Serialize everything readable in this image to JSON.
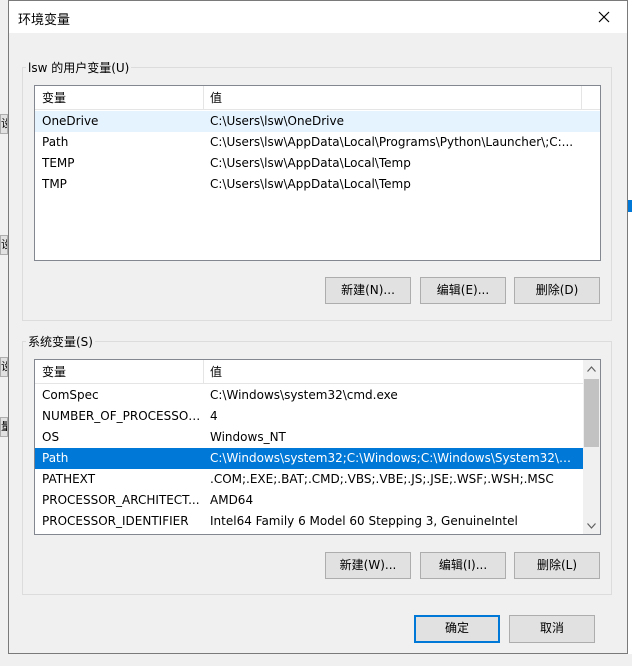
{
  "dialog": {
    "title": "环境变量",
    "ok_label": "确定",
    "cancel_label": "取消"
  },
  "user_vars": {
    "group_label": "lsw 的用户变量(U)",
    "col_variable": "变量",
    "col_value": "值",
    "rows": [
      {
        "name": "OneDrive",
        "value": "C:\\Users\\lsw\\OneDrive"
      },
      {
        "name": "Path",
        "value": "C:\\Users\\lsw\\AppData\\Local\\Programs\\Python\\Launcher\\;C:..."
      },
      {
        "name": "TEMP",
        "value": "C:\\Users\\lsw\\AppData\\Local\\Temp"
      },
      {
        "name": "TMP",
        "value": "C:\\Users\\lsw\\AppData\\Local\\Temp"
      }
    ],
    "new_label": "新建(N)...",
    "edit_label": "编辑(E)...",
    "delete_label": "删除(D)"
  },
  "system_vars": {
    "group_label": "系统变量(S)",
    "col_variable": "变量",
    "col_value": "值",
    "rows": [
      {
        "name": "ComSpec",
        "value": "C:\\Windows\\system32\\cmd.exe"
      },
      {
        "name": "NUMBER_OF_PROCESSORS",
        "value": "4"
      },
      {
        "name": "OS",
        "value": "Windows_NT"
      },
      {
        "name": "Path",
        "value": "C:\\Windows\\system32;C:\\Windows;C:\\Windows\\System32\\Wb..."
      },
      {
        "name": "PATHEXT",
        "value": ".COM;.EXE;.BAT;.CMD;.VBS;.VBE;.JS;.JSE;.WSF;.WSH;.MSC"
      },
      {
        "name": "PROCESSOR_ARCHITECT...",
        "value": "AMD64"
      },
      {
        "name": "PROCESSOR_IDENTIFIER",
        "value": "Intel64 Family 6 Model 60 Stepping 3, GenuineIntel"
      }
    ],
    "selected_index": 3,
    "new_label": "新建(W)...",
    "edit_label": "编辑(I)...",
    "delete_label": "删除(L)"
  },
  "background": {
    "frag1": "设",
    "frag2": "设",
    "frag3": "设",
    "frag4": "量"
  },
  "colors": {
    "selection": "#0078d7",
    "hover": "#e5f3ff"
  }
}
